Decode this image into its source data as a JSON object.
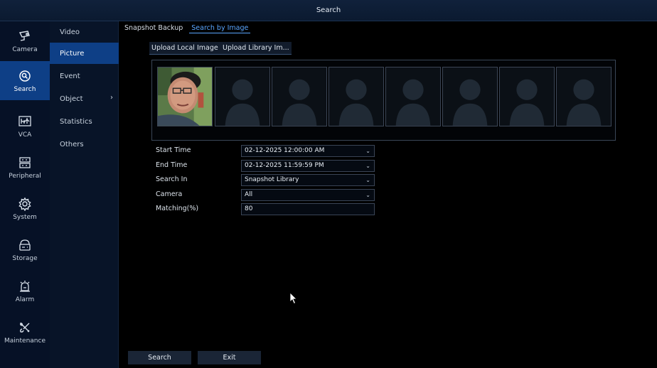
{
  "window": {
    "title": "Search"
  },
  "nav": [
    {
      "label": "Camera",
      "icon": "camera-icon",
      "active": false
    },
    {
      "label": "Search",
      "icon": "search-icon",
      "active": true
    },
    {
      "label": "VCA",
      "icon": "vca-icon",
      "active": false
    },
    {
      "label": "Peripheral",
      "icon": "peripheral-icon",
      "active": false
    },
    {
      "label": "System",
      "icon": "gear-icon",
      "active": false
    },
    {
      "label": "Storage",
      "icon": "storage-icon",
      "active": false
    },
    {
      "label": "Alarm",
      "icon": "alarm-icon",
      "active": false
    },
    {
      "label": "Maintenance",
      "icon": "tools-icon",
      "active": false
    }
  ],
  "subnav": [
    {
      "label": "Video",
      "active": false
    },
    {
      "label": "Picture",
      "active": true
    },
    {
      "label": "Event",
      "active": false
    },
    {
      "label": "Object",
      "active": false,
      "chevron": "›"
    },
    {
      "label": "Statistics",
      "active": false
    },
    {
      "label": "Others",
      "active": false
    }
  ],
  "tabs": [
    {
      "label": "Snapshot Backup",
      "active": false
    },
    {
      "label": "Search by Image",
      "active": true
    }
  ],
  "upload": {
    "local_label": "Upload Local Image",
    "library_label": "Upload Library Im..."
  },
  "gallery": {
    "slots": [
      {
        "type": "photo"
      },
      {
        "type": "placeholder"
      },
      {
        "type": "placeholder"
      },
      {
        "type": "placeholder"
      },
      {
        "type": "placeholder"
      },
      {
        "type": "placeholder"
      },
      {
        "type": "placeholder"
      },
      {
        "type": "placeholder"
      }
    ]
  },
  "form": {
    "start_time": {
      "label": "Start Time",
      "value": "02-12-2025 12:00:00 AM"
    },
    "end_time": {
      "label": "End Time",
      "value": "02-12-2025 11:59:59 PM"
    },
    "search_in": {
      "label": "Search In",
      "value": "Snapshot Library"
    },
    "camera": {
      "label": "Camera",
      "value": "All"
    },
    "matching": {
      "label": "Matching(%)",
      "value": "80"
    }
  },
  "buttons": {
    "search_label": "Search",
    "exit_label": "Exit"
  },
  "colors": {
    "accent": "#0e3f86",
    "tab_active": "#5aa6ff",
    "titlebar": "#0b1a30",
    "nav_bg": "#061126"
  }
}
